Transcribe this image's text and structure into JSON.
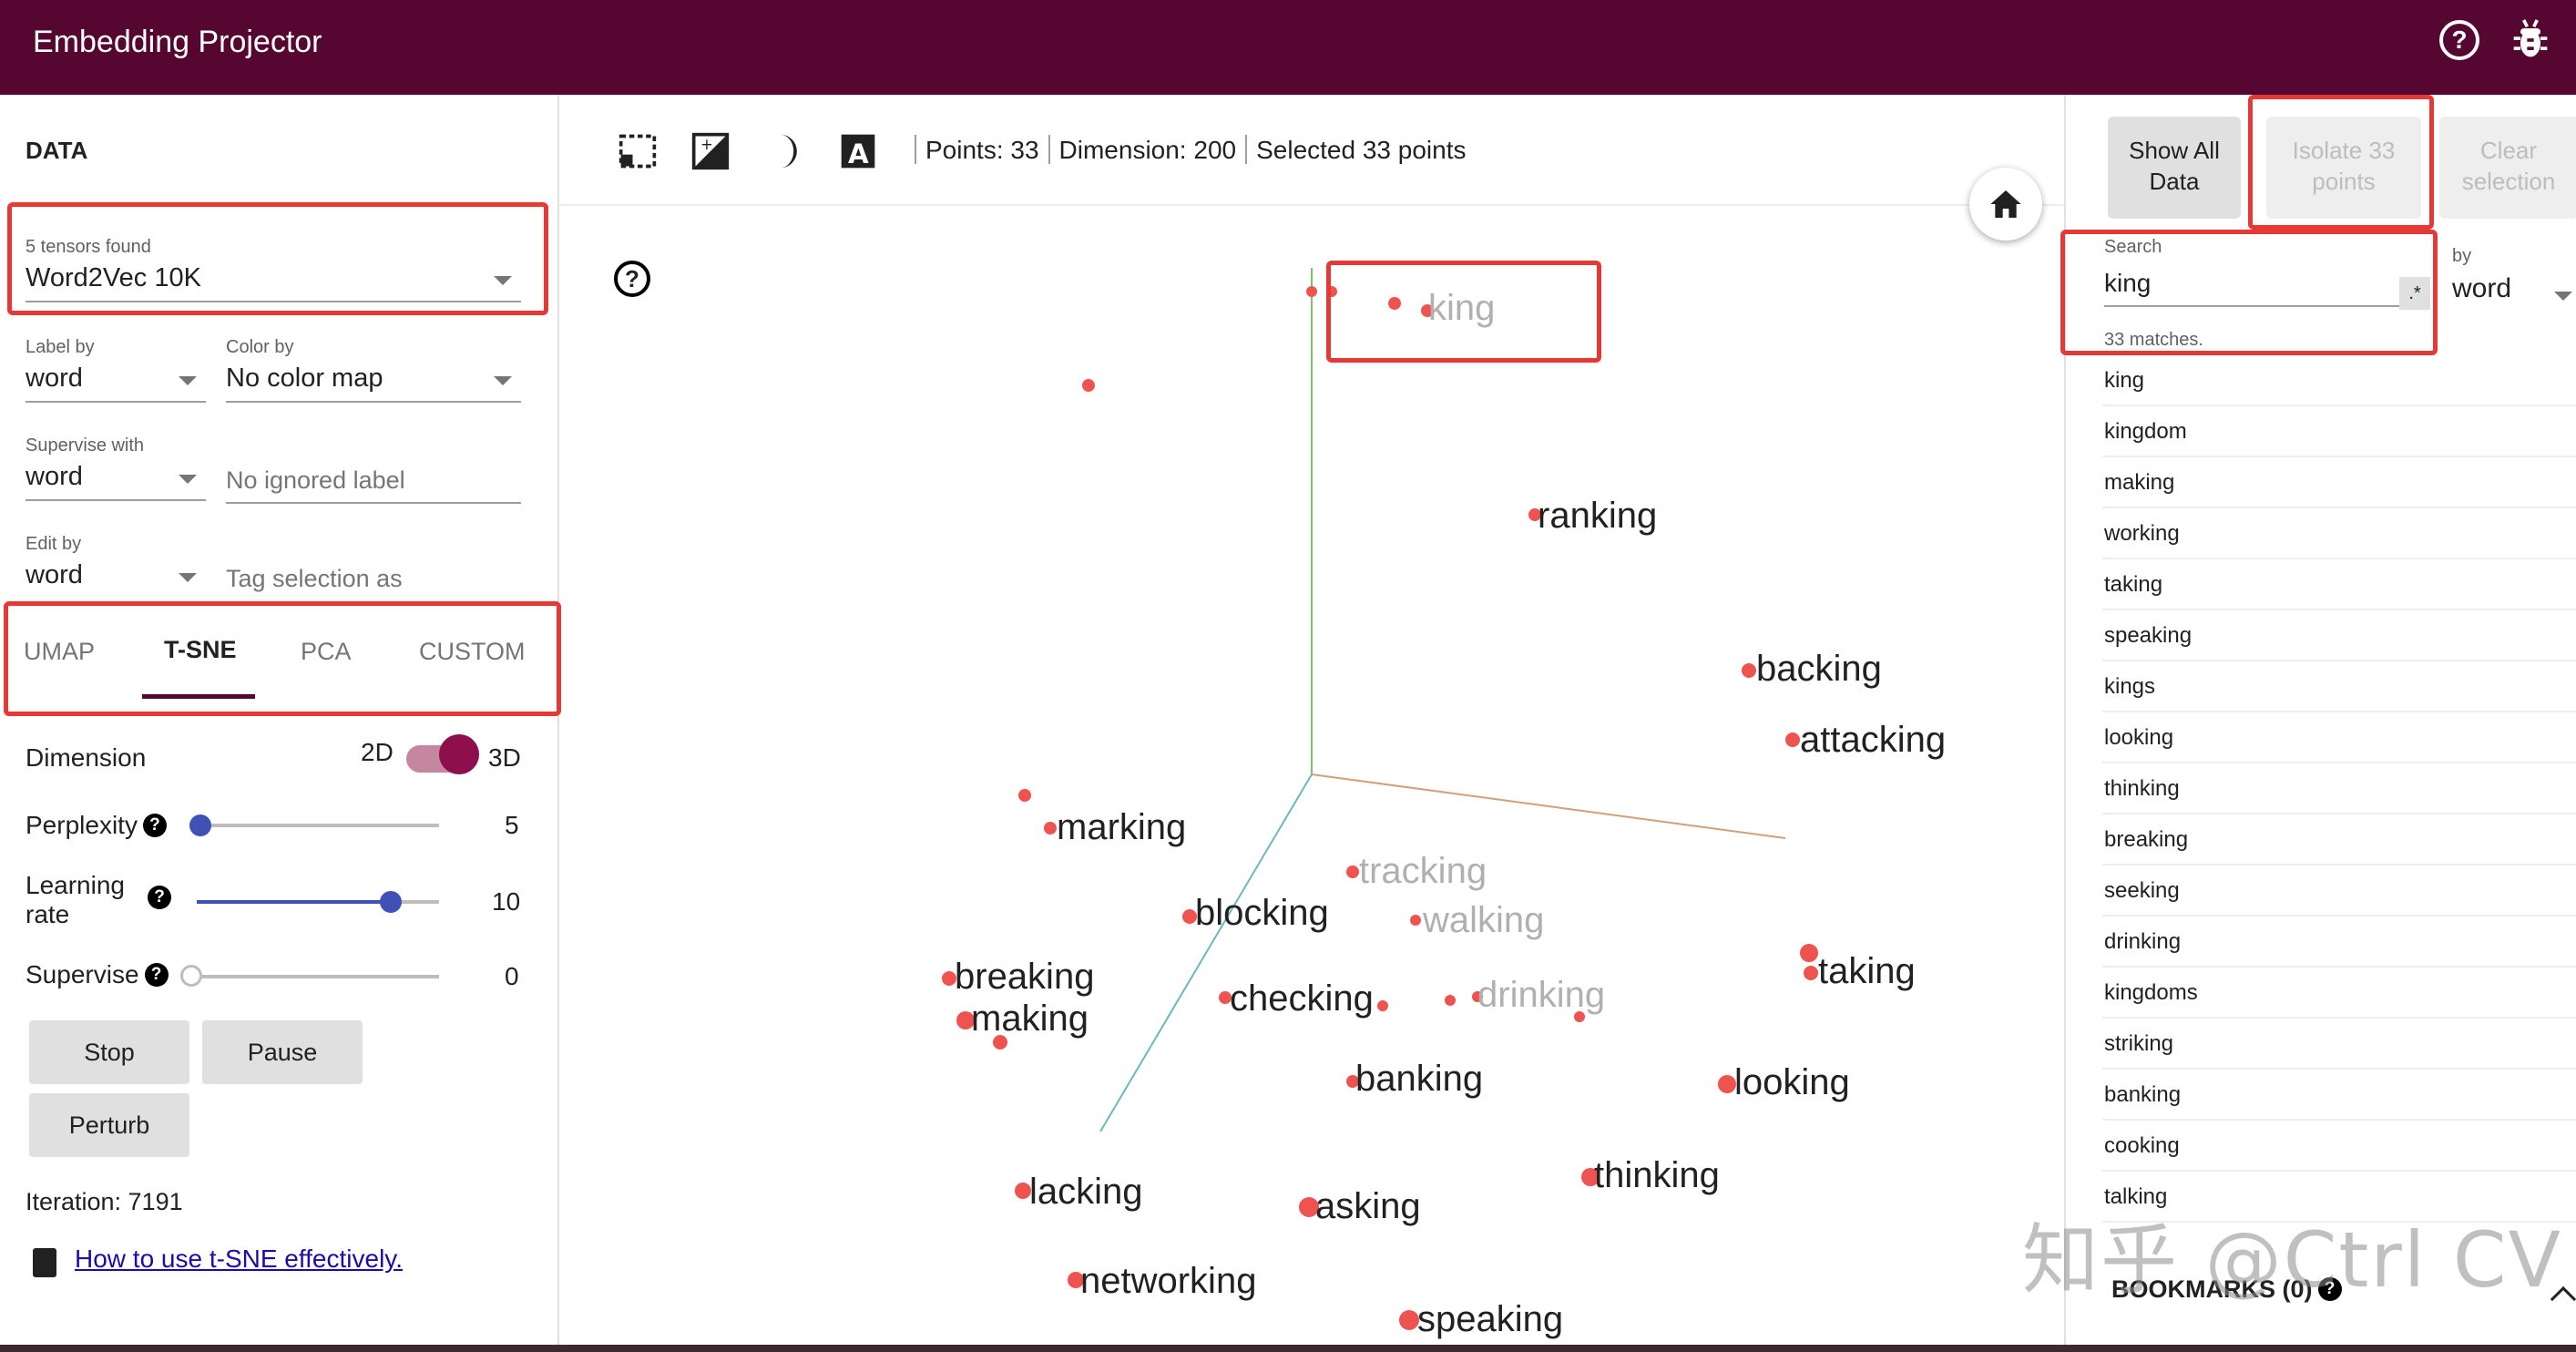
{
  "header": {
    "title": "Embedding Projector"
  },
  "data_panel": {
    "title": "DATA",
    "tensors": {
      "label": "5 tensors found",
      "value": "Word2Vec 10K"
    },
    "label_by": {
      "label": "Label by",
      "value": "word"
    },
    "color_by": {
      "label": "Color by",
      "value": "No color map"
    },
    "supervise_with": {
      "label": "Supervise with",
      "value": "word",
      "ignored_placeholder": "No ignored label"
    },
    "edit_by": {
      "label": "Edit by",
      "value": "word",
      "tag_placeholder": "Tag selection as"
    },
    "tabs": [
      "UMAP",
      "T-SNE",
      "PCA",
      "CUSTOM"
    ],
    "active_tab": "T-SNE",
    "dimension": {
      "label": "Dimension",
      "off": "2D",
      "on": "3D",
      "value": "3D"
    },
    "perplexity": {
      "label": "Perplexity",
      "value": "5",
      "fraction": 0.0
    },
    "learning_rate": {
      "label_line1": "Learning",
      "label_line2": "rate",
      "value": "10",
      "fraction": 0.8
    },
    "supervise": {
      "label": "Supervise",
      "value": "0",
      "fraction": 0.0
    },
    "buttons": {
      "stop": "Stop",
      "pause": "Pause",
      "perturb": "Perturb"
    },
    "iteration": "Iteration: 7191",
    "help_link": "How to use t-SNE effectively."
  },
  "toolbar": {
    "points": "Points: 33",
    "dimension": "Dimension: 200",
    "selected": "Selected 33 points"
  },
  "plot": {
    "words": [
      {
        "text": "king",
        "faded": true
      },
      {
        "text": "ranking",
        "faded": false
      },
      {
        "text": "backing",
        "faded": false
      },
      {
        "text": "attacking",
        "faded": false
      },
      {
        "text": "marking",
        "faded": false
      },
      {
        "text": "tracking",
        "faded": true
      },
      {
        "text": "blocking",
        "faded": false
      },
      {
        "text": "walking",
        "faded": true
      },
      {
        "text": "taking",
        "faded": false
      },
      {
        "text": "breaking",
        "faded": false
      },
      {
        "text": "making",
        "faded": false
      },
      {
        "text": "checking",
        "faded": false
      },
      {
        "text": "drinking",
        "faded": true
      },
      {
        "text": "banking",
        "faded": false
      },
      {
        "text": "looking",
        "faded": false
      },
      {
        "text": "thinking",
        "faded": false
      },
      {
        "text": "lacking",
        "faded": false
      },
      {
        "text": "asking",
        "faded": false
      },
      {
        "text": "networking",
        "faded": false
      },
      {
        "text": "speaking",
        "faded": false
      }
    ]
  },
  "inspector": {
    "show_all": "Show All Data",
    "isolate": "Isolate 33 points",
    "clear": "Clear selection",
    "search_label": "Search",
    "search_value": "king",
    "regex_label": ".*",
    "matches": "33 matches.",
    "by_label": "by",
    "by_value": "word",
    "results": [
      "king",
      "kingdom",
      "making",
      "working",
      "taking",
      "speaking",
      "kings",
      "looking",
      "thinking",
      "breaking",
      "seeking",
      "drinking",
      "kingdoms",
      "striking",
      "banking",
      "cooking",
      "talking"
    ],
    "bookmarks": "BOOKMARKS (0)"
  },
  "watermark": "知乎 @Ctrl CV",
  "colors": {
    "header": "#560731",
    "accent": "#3f51b5",
    "point": "#ef5350",
    "highlight": "#e53935"
  }
}
